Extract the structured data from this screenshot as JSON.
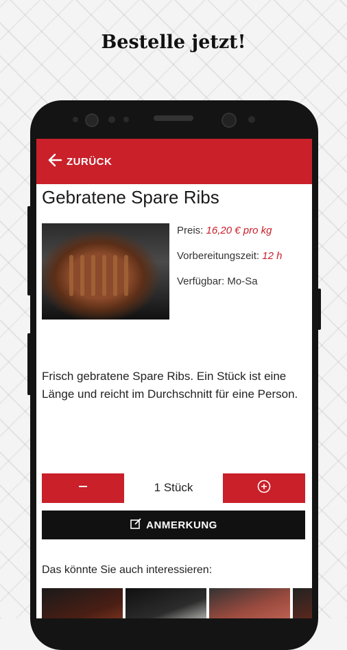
{
  "headline": "Bestelle jetzt!",
  "appbar": {
    "back_label": "ZURÜCK",
    "back_icon": "arrow-left-icon"
  },
  "product": {
    "title": "Gebratene Spare Ribs",
    "price_label": "Preis:",
    "price_value": "16,20 € pro kg",
    "prep_label": "Vorbereitungszeit:",
    "prep_value": "12 h",
    "available_label": "Verfügbar: Mo-Sa",
    "description": "Frisch gebratene Spare Ribs. Ein Stück ist eine Länge und reicht im Durchschnitt für eine Person."
  },
  "quantity": {
    "label": "1 Stück"
  },
  "note_button": {
    "label": "ANMERKUNG",
    "icon": "edit-icon"
  },
  "related": {
    "title": "Das könnte Sie auch interessieren:"
  },
  "colors": {
    "accent": "#c9202a",
    "dark": "#111111"
  }
}
